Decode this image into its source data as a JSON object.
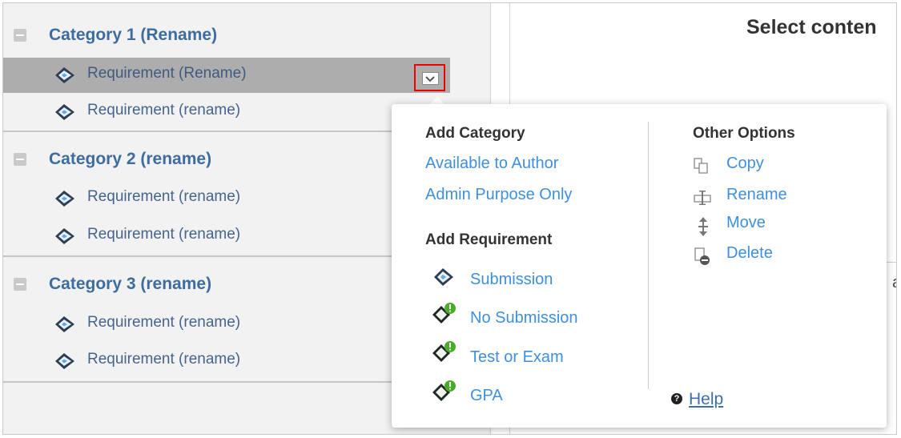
{
  "tree": {
    "categories": [
      {
        "label": "Category 1 (Rename)",
        "requirements": [
          "Requirement (Rename)",
          "Requirement (rename)"
        ]
      },
      {
        "label": "Category 2 (rename)",
        "requirements": [
          "Requirement (rename)",
          "Requirement (rename)"
        ]
      },
      {
        "label": "Category 3 (rename)",
        "requirements": [
          "Requirement (rename)",
          "Requirement (rename)"
        ]
      }
    ]
  },
  "main": {
    "title": "Select conten",
    "stray_text": "a"
  },
  "popup": {
    "add_category": {
      "heading": "Add Category",
      "items": [
        "Available to Author",
        "Admin Purpose Only"
      ]
    },
    "add_requirement": {
      "heading": "Add Requirement",
      "items": [
        "Submission",
        "No Submission",
        "Test or Exam",
        "GPA"
      ]
    },
    "other_options": {
      "heading": "Other Options",
      "items": [
        "Copy",
        "Rename",
        "Move",
        "Delete"
      ]
    },
    "help": {
      "label": "Help"
    }
  },
  "colors": {
    "link": "#3f8fdc",
    "category": "#3e6c9f",
    "selected_row": "#adadad",
    "highlight_border": "#e00000"
  }
}
